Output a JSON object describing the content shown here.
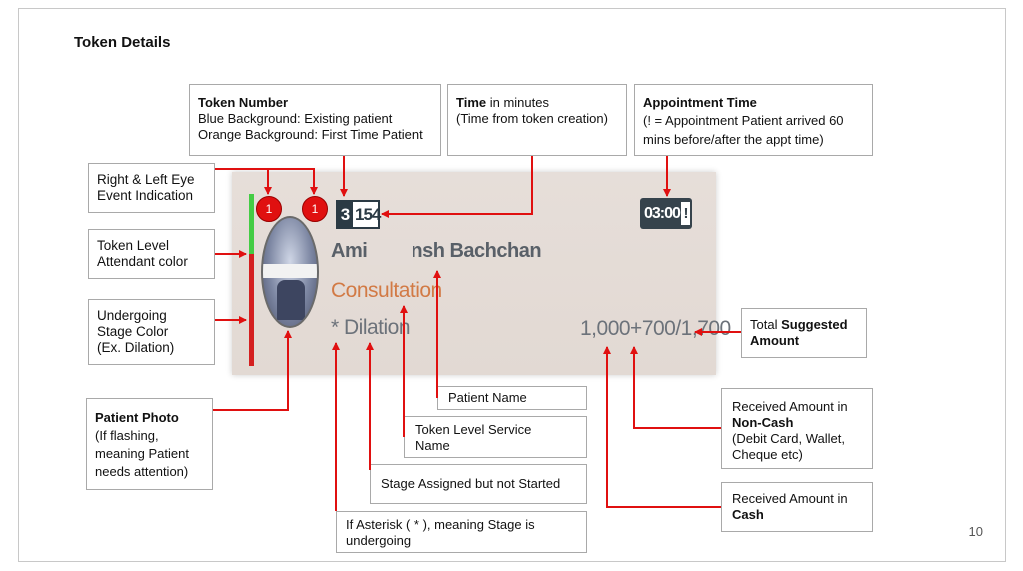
{
  "title": "Token Details",
  "page_number": "10",
  "card": {
    "left_eye_event": "1",
    "right_eye_event": "1",
    "token_prefix": "3",
    "token_number": "154",
    "appointment_time": "03:00",
    "appointment_flag": "!",
    "patient_name": "Amitabh Bachchan",
    "patient_name_display": "Amita        vansh Bachchan",
    "service_name": "Consultation",
    "stage": "* Dilation",
    "amount": "1,000+700/1,700"
  },
  "callouts": {
    "token_number": {
      "title": "Token Number",
      "line1": "Blue Background: Existing patient",
      "line2": "Orange Background: First Time Patient"
    },
    "time": {
      "title": "Time",
      "title_rest": " in minutes",
      "line1": "(Time from token creation)"
    },
    "appointment": {
      "title": "Appointment Time",
      "line1": "(! = Appointment Patient arrived 60 mins before/after the appt time)"
    },
    "eye_event": {
      "line1": "Right & Left Eye",
      "line2": "Event Indication"
    },
    "attendant": {
      "line1": "Token Level",
      "line2": "Attendant color"
    },
    "stage_color": {
      "line1": "Undergoing",
      "line2": "Stage Color",
      "line3": "(Ex. Dilation)"
    },
    "photo": {
      "title": "Patient Photo",
      "line1": "(If flashing,",
      "line2": "meaning Patient",
      "line3": "needs attention)"
    },
    "suggested": {
      "pre": "Total ",
      "bold": "Suggested",
      "bold2": "Amount"
    },
    "patient_name": {
      "text": "Patient Name"
    },
    "service": {
      "line1": "Token Level Service",
      "line2": "Name"
    },
    "stage_not_started": {
      "text": "Stage Assigned but not Started"
    },
    "asterisk": {
      "line1": "If Asterisk ( * ), meaning Stage is",
      "line2": "undergoing"
    },
    "noncash": {
      "line1": "Received Amount in",
      "bold": "Non-Cash",
      "line2": "(Debit Card, Wallet,",
      "line3": "Cheque etc)"
    },
    "cash": {
      "line1": "Received Amount in",
      "bold": "Cash"
    }
  },
  "colors": {
    "arrow": "#e01010",
    "attendant_bar": "#44cc44",
    "stage_bar": "#d42020",
    "token_existing": "#2b3a44",
    "service_text": "#d27a45"
  }
}
